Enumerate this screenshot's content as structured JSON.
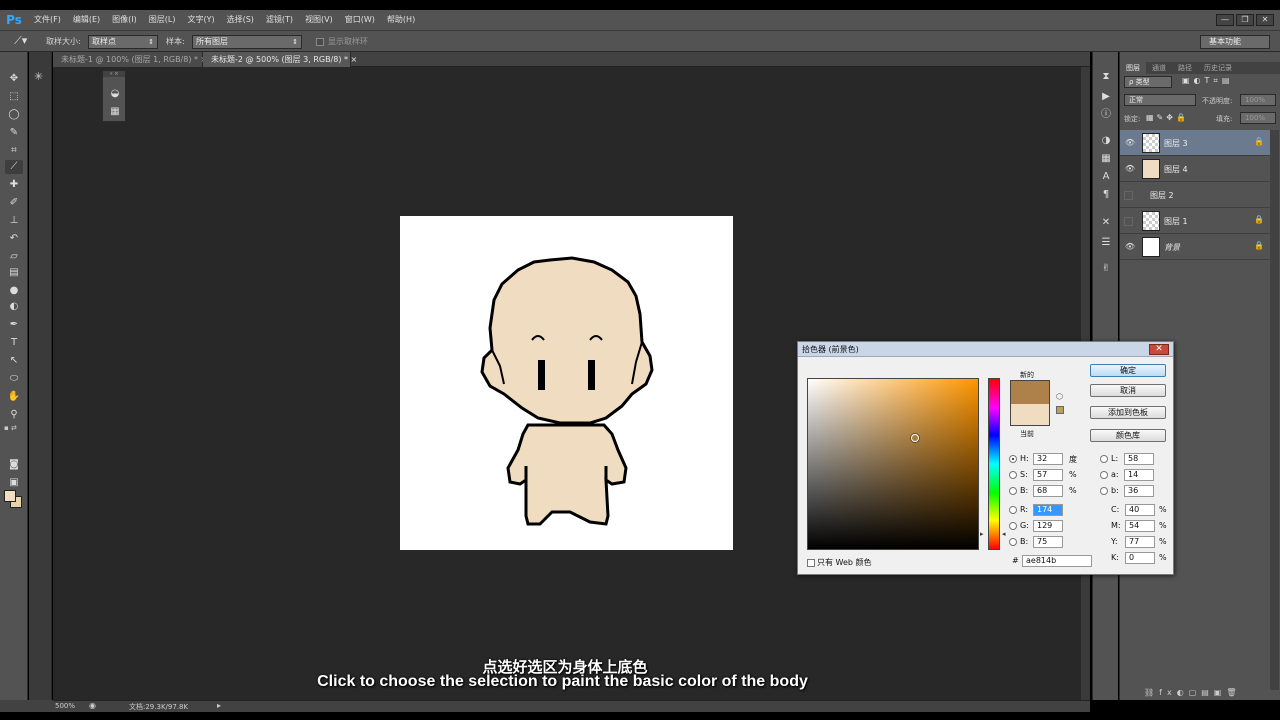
{
  "menubar": {
    "logo": "Ps",
    "items": [
      "文件(F)",
      "编辑(E)",
      "图像(I)",
      "图层(L)",
      "文字(Y)",
      "选择(S)",
      "滤镜(T)",
      "视图(V)",
      "窗口(W)",
      "帮助(H)"
    ],
    "win_min": "—",
    "win_restore": "❐",
    "win_close": "✕"
  },
  "options": {
    "size_label": "取样大小:",
    "size_value": "取样点",
    "sample_label": "样本:",
    "sample_value": "所有图层",
    "show_ring": "显示取样环",
    "workspace": "基本功能"
  },
  "tabs": [
    {
      "label": "未标题-1 @ 100% (图层 1, RGB/8) * ×"
    },
    {
      "label": "未标题-2 @ 500% (图层 3, RGB/8) * ×"
    }
  ],
  "status": {
    "zoom": "500%",
    "doc": "文档:29.3K/97.8K"
  },
  "subtitles": {
    "cn": "点选好选区为身体上底色",
    "en": "Click to choose the selection to paint the basic color of the body"
  },
  "layers_panel": {
    "tabs": [
      "图层",
      "通道",
      "路径",
      "历史记录"
    ],
    "kind": "ρ 类型",
    "blend": "正常",
    "opacity_label": "不透明度:",
    "opacity": "100%",
    "lock_label": "锁定:",
    "fill_label": "填充:",
    "fill": "100%",
    "layers": [
      {
        "name": "图层 3",
        "selected": true,
        "thumb": "#e6e6e6"
      },
      {
        "name": "图层 4",
        "selected": false,
        "thumb": "#f0dcc0"
      },
      {
        "name": "图层 2",
        "selected": false,
        "thumb": ""
      },
      {
        "name": "图层 1",
        "selected": false,
        "thumb": "#e6e6e6"
      },
      {
        "name": "背景",
        "selected": false,
        "thumb": "#ffffff"
      }
    ]
  },
  "picker": {
    "title": "拾色器 (前景色)",
    "new_label": "新的",
    "current_label": "当前",
    "ok": "确定",
    "cancel": "取消",
    "add_swatch": "添加到色板",
    "libraries": "颜色库",
    "new_color": "#ae814b",
    "current_color": "#f0dcc0",
    "fields": {
      "H": "32",
      "S": "57",
      "Bv": "68",
      "R": "174",
      "G": "129",
      "B": "75",
      "L": "58",
      "a": "14",
      "b": "36",
      "C": "40",
      "M": "54",
      "Y": "77",
      "K": "0"
    },
    "units": {
      "deg": "度",
      "pct": "%"
    },
    "web_only": "只有 Web 颜色",
    "hex": "ae814b"
  },
  "colors": {
    "foreground": "#f0dcc0",
    "background": "#e8d4a8",
    "skin": "#f0dcc0",
    "outline": "#000000"
  }
}
